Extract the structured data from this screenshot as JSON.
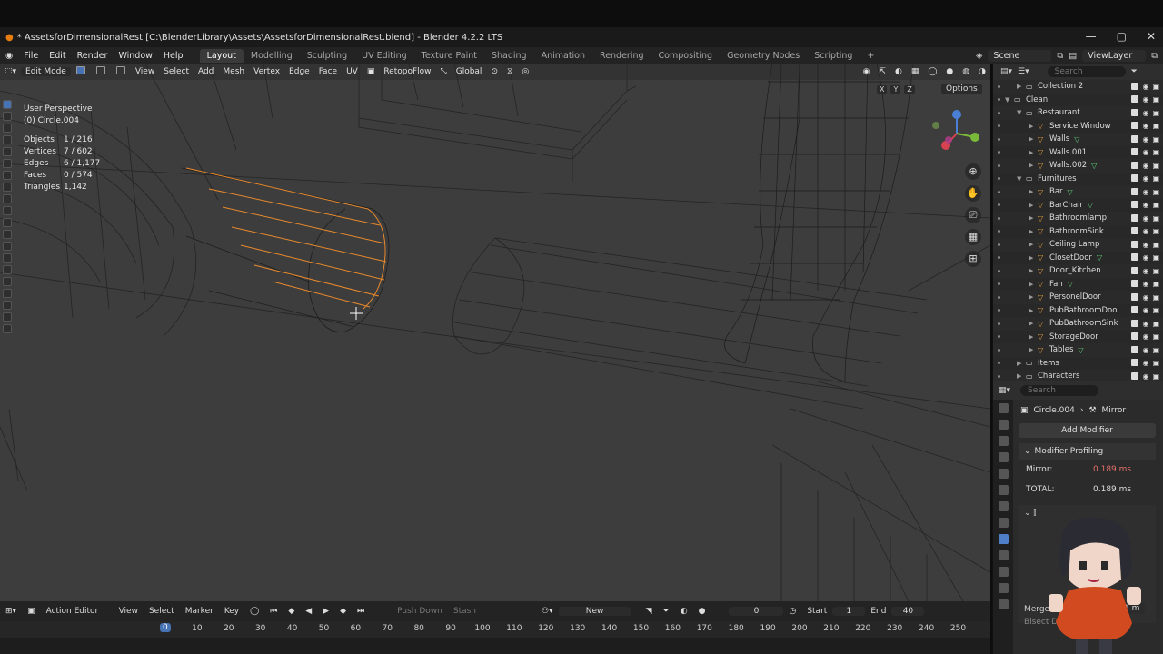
{
  "window": {
    "title": "* AssetsforDimensionalRest [C:\\BlenderLibrary\\Assets\\AssetsforDimensionalRest.blend] - Blender 4.2.2 LTS"
  },
  "menu": {
    "items": [
      "File",
      "Edit",
      "Render",
      "Window",
      "Help"
    ],
    "workspaces": [
      "Layout",
      "Modelling",
      "Sculpting",
      "UV Editing",
      "Texture Paint",
      "Shading",
      "Animation",
      "Rendering",
      "Compositing",
      "Geometry Nodes",
      "Scripting"
    ],
    "active_workspace": "Layout",
    "scene": "Scene",
    "view_layer": "ViewLayer"
  },
  "viewport_header": {
    "mode": "Edit Mode",
    "menus": [
      "View",
      "Select",
      "Add",
      "Mesh",
      "Vertex",
      "Edge",
      "Face",
      "UV"
    ],
    "addon": "RetopoFlow",
    "transform": "Global",
    "options": "Options"
  },
  "overlay": {
    "view": "User Perspective",
    "object": "(0) Circle.004",
    "stats": [
      {
        "label": "Objects",
        "value": "1 / 216"
      },
      {
        "label": "Vertices",
        "value": "7 / 602"
      },
      {
        "label": "Edges",
        "value": "6 / 1,177"
      },
      {
        "label": "Faces",
        "value": "0 / 574"
      },
      {
        "label": "Triangles",
        "value": "1,142"
      }
    ]
  },
  "xyz": [
    "X",
    "Y",
    "Z"
  ],
  "outliner": {
    "search_placeholder": "Search",
    "rows": [
      {
        "name": "Collection 2",
        "indent": 2,
        "type": "coll"
      },
      {
        "name": "Clean",
        "indent": 1,
        "type": "coll",
        "open": true
      },
      {
        "name": "Restaurant",
        "indent": 2,
        "type": "coll",
        "open": true
      },
      {
        "name": "Service Window",
        "indent": 3,
        "type": "obj"
      },
      {
        "name": "Walls",
        "indent": 3,
        "type": "obj",
        "mod": true
      },
      {
        "name": "Walls.001",
        "indent": 3,
        "type": "obj"
      },
      {
        "name": "Walls.002",
        "indent": 3,
        "type": "obj",
        "mod": true
      },
      {
        "name": "Furnitures",
        "indent": 2,
        "type": "coll",
        "open": true
      },
      {
        "name": "Bar",
        "indent": 3,
        "type": "obj",
        "mod": true
      },
      {
        "name": "BarChair",
        "indent": 3,
        "type": "obj",
        "mod": true
      },
      {
        "name": "Bathroomlamp",
        "indent": 3,
        "type": "obj"
      },
      {
        "name": "BathroomSink",
        "indent": 3,
        "type": "obj"
      },
      {
        "name": "Ceiling Lamp",
        "indent": 3,
        "type": "obj"
      },
      {
        "name": "ClosetDoor",
        "indent": 3,
        "type": "obj",
        "mod": true
      },
      {
        "name": "Door_Kitchen",
        "indent": 3,
        "type": "obj"
      },
      {
        "name": "Fan",
        "indent": 3,
        "type": "obj",
        "mod": true
      },
      {
        "name": "PersonelDoor",
        "indent": 3,
        "type": "obj"
      },
      {
        "name": "PubBathroomDoo",
        "indent": 3,
        "type": "obj"
      },
      {
        "name": "PubBathroomSink",
        "indent": 3,
        "type": "obj"
      },
      {
        "name": "StorageDoor",
        "indent": 3,
        "type": "obj"
      },
      {
        "name": "Tables",
        "indent": 3,
        "type": "obj",
        "mod": true
      },
      {
        "name": "Items",
        "indent": 2,
        "type": "coll"
      },
      {
        "name": "Characters",
        "indent": 2,
        "type": "coll"
      }
    ]
  },
  "properties": {
    "search_placeholder": "Search",
    "object": "Circle.004",
    "modifier": "Mirror",
    "add_modifier": "Add Modifier",
    "panel": "Modifier Profiling",
    "profiling": [
      {
        "label": "Mirror:",
        "value": "0.189 ms",
        "highlight": true
      },
      {
        "label": "TOTAL:",
        "value": "0.189 ms",
        "highlight": false
      }
    ],
    "merge_label": "Merge",
    "bisect_label": "Bisect Dist.",
    "merge_value": "1 m"
  },
  "timeline": {
    "editor": "Action Editor",
    "menus": [
      "View",
      "Select",
      "Marker",
      "Key"
    ],
    "push_down": "Push Down",
    "stash": "Stash",
    "new": "New",
    "current_frame": "0",
    "start_label": "Start",
    "start": "1",
    "end_label": "End",
    "end": "40",
    "ruler": [
      "0",
      "10",
      "20",
      "30",
      "40",
      "50",
      "60",
      "70",
      "80",
      "90",
      "100",
      "110",
      "120",
      "130",
      "140",
      "150",
      "160",
      "170",
      "180",
      "190",
      "200",
      "210",
      "220",
      "230",
      "240",
      "250"
    ]
  },
  "colors": {
    "viewport_bg": "#3d3d3d",
    "selected_edge": "#e8892c",
    "accent": "#4772b3"
  }
}
